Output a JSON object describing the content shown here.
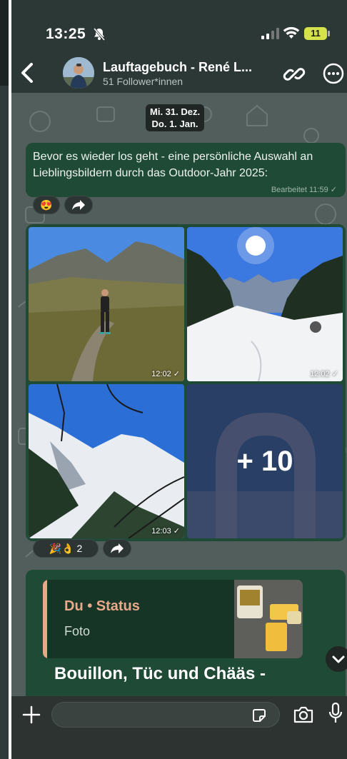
{
  "status_bar": {
    "time": "13:25",
    "battery": "11"
  },
  "header": {
    "channel_name": "Lauftagebuch - René L...",
    "followers": "51 Follower*innen"
  },
  "chat": {
    "date_chip_line1": "Mi. 31. Dez.",
    "date_chip_line2": "Do. 1. Jan.",
    "text_message": {
      "body": "Bevor es wieder los geht - eine persönliche Auswahl an Lieblingsbildern durch das Outdoor-Jahr 2025:",
      "meta": "Bearbeitet 11:59 ✓"
    },
    "reactions_1": {
      "emoji": "😍"
    },
    "album": {
      "tiles": [
        {
          "time": "12:02 ✓"
        },
        {
          "time": "12:02 ✓"
        },
        {
          "time": "12:03 ✓"
        }
      ],
      "more_count": "+ 10"
    },
    "reactions_2": {
      "emojis": "🎉👌",
      "count": "2"
    },
    "status_reply": {
      "quote_author": "Du • Status",
      "quote_type": "Foto",
      "text": "Bouillon, Tüc und Chääs -"
    }
  },
  "colors": {
    "bubble": "#1f4a36",
    "accent_quote": "#e8a98a",
    "chat_bg": "#515e5b"
  },
  "icons": [
    "bell-off-icon",
    "signal-icon",
    "wifi-icon",
    "back-icon",
    "link-icon",
    "more-icon",
    "forward-icon",
    "chevron-down-icon",
    "plus-icon",
    "sticker-icon",
    "camera-icon",
    "mic-icon"
  ]
}
